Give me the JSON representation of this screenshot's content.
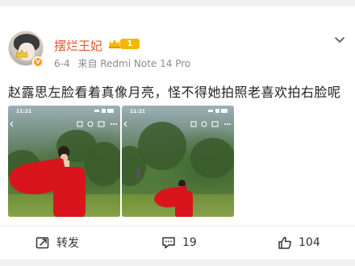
{
  "post": {
    "username": "摆烂王妃",
    "level": "1",
    "date": "6-4",
    "source": "来自 Redmi Note 14 Pro",
    "text": "赵露思左脸看着真像月亮，怪不得她拍照老喜欢拍右脸呢",
    "images": [
      {
        "time": "11:21"
      },
      {
        "time": "11:21"
      }
    ]
  },
  "actions": {
    "repost_label": "转发",
    "comment_count": "19",
    "like_count": "104"
  },
  "colors": {
    "username": "#e8532d",
    "level_badge": "#f7b500",
    "verified_badge": "#ff9b1a",
    "dress": "#d8151c"
  },
  "icons": [
    "crown-icon",
    "verified-badge-icon",
    "chevron-down-icon",
    "repost-icon",
    "comment-icon",
    "like-icon"
  ]
}
